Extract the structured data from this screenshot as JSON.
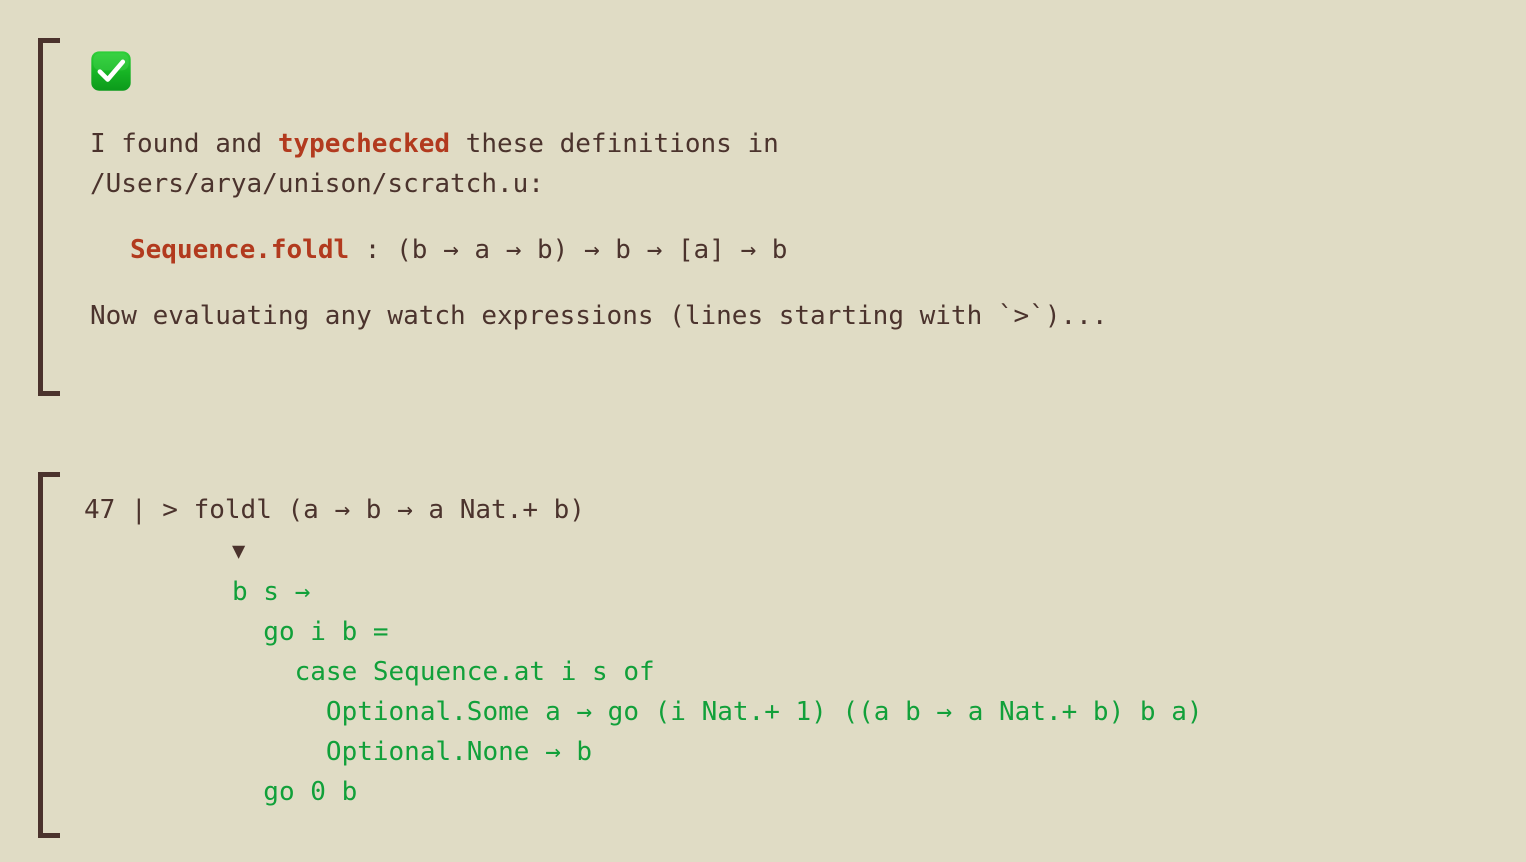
{
  "theme": {
    "background": "#e0dcc5",
    "text": "#4b332d",
    "accent": "#b23a1e",
    "success_green": "#11a03a",
    "bracket": "#4b332d"
  },
  "blocks": [
    {
      "name": "typecheck-success-block",
      "status_icon": "white-check-mark-icon",
      "message_line_1_a": "I found and ",
      "message_line_1_bold": "typechecked",
      "message_line_1_b": " these definitions in",
      "message_line_2": "/Users/arya/unison/scratch.u:",
      "definition": {
        "name": "Sequence.foldl",
        "signature": " : (b → a → b) → b → [a] → b"
      },
      "footer": "Now evaluating any watch expressions (lines starting with `>`)..."
    },
    {
      "name": "watch-expression-block",
      "watch_line_number": "47",
      "watch_separator": "|",
      "watch_prompt": ">",
      "watch_expression": "foldl (a → b → a Nat.+ b)",
      "result_marker": "▼",
      "result_lines": [
        "b s →",
        "  go i b =",
        "    case Sequence.at i s of",
        "      Optional.Some a → go (i Nat.+ 1) ((a b → a Nat.+ b) b a)",
        "      Optional.None → b",
        "  go 0 b"
      ]
    }
  ]
}
